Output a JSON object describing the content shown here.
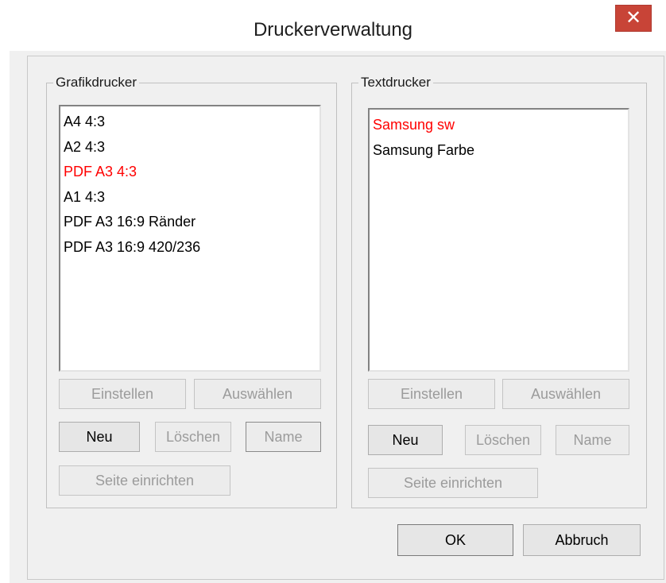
{
  "window": {
    "title": "Druckerverwaltung",
    "close_glyph": "✕"
  },
  "grafik": {
    "legend": "Grafikdrucker",
    "items": [
      {
        "label": "A4 4:3",
        "selected": false
      },
      {
        "label": "A2 4:3",
        "selected": false
      },
      {
        "label": "PDF A3 4:3",
        "selected": true
      },
      {
        "label": "A1 4:3",
        "selected": false
      },
      {
        "label": "PDF A3 16:9 Ränder",
        "selected": false
      },
      {
        "label": "PDF A3 16:9 420/236",
        "selected": false
      }
    ],
    "buttons": {
      "einstellen": "Einstellen",
      "auswaehlen": "Auswählen",
      "neu": "Neu",
      "loeschen": "Löschen",
      "name": "Name",
      "seite": "Seite einrichten"
    }
  },
  "text": {
    "legend": "Textdrucker",
    "items": [
      {
        "label": "Samsung sw",
        "selected": true
      },
      {
        "label": "Samsung Farbe",
        "selected": false
      }
    ],
    "buttons": {
      "einstellen": "Einstellen",
      "auswaehlen": "Auswählen",
      "neu": "Neu",
      "loeschen": "Löschen",
      "name": "Name",
      "seite": "Seite einrichten"
    }
  },
  "footer": {
    "ok": "OK",
    "abbruch": "Abbruch"
  },
  "colors": {
    "selected_text": "#ff0000",
    "close_button": "#c84437"
  }
}
